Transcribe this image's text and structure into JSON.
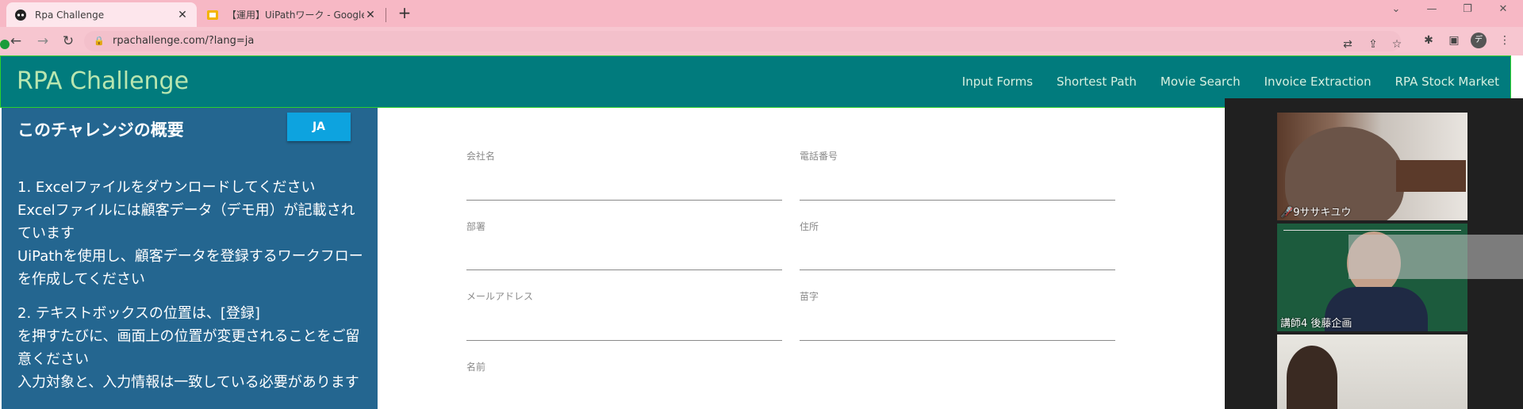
{
  "browser": {
    "tabs": [
      {
        "title": "Rpa Challenge",
        "active": true
      },
      {
        "title": "【運用】UiPathワーク - Google スライ",
        "active": false
      }
    ],
    "new_tab": "+",
    "window_controls": {
      "down": "⌄",
      "minimize": "—",
      "restore": "❐",
      "close": "✕"
    },
    "url": "rpachallenge.com/?lang=ja",
    "profile_initial": "デ"
  },
  "site": {
    "brand": "RPA Challenge",
    "nav": [
      "Input Forms",
      "Shortest Path",
      "Movie Search",
      "Invoice Extraction",
      "RPA Stock Market"
    ]
  },
  "panel": {
    "title": "このチャレンジの概要",
    "lang_button": "JA",
    "paragraphs": [
      [
        "1. Excelファイルをダウンロードしてください",
        "Excelファイルには顧客データ（デモ用）が記載されています",
        "UiPathを使用し、顧客データを登録するワークフローを作成してください"
      ],
      [
        "2. テキストボックスの位置は、[登録]",
        "を押すたびに、画面上の位置が変更されることをご留意ください",
        "入力対象と、入力情報は一致している必要があります"
      ]
    ]
  },
  "form": {
    "fields": [
      {
        "label": "会社名"
      },
      {
        "label": "電話番号"
      },
      {
        "label": "部署"
      },
      {
        "label": "住所"
      },
      {
        "label": "メールアドレス"
      },
      {
        "label": "苗字"
      },
      {
        "label": "名前"
      }
    ]
  },
  "video": {
    "participants": [
      {
        "name": "9ササキユウ",
        "muted": true
      },
      {
        "name": "講師4 後藤企画",
        "muted": false
      },
      {
        "name": "",
        "muted": false
      }
    ]
  },
  "colors": {
    "tabstrip": "#f7b8c5",
    "header": "#017b7d",
    "panel": "#246690",
    "ja_button": "#0da3df"
  }
}
